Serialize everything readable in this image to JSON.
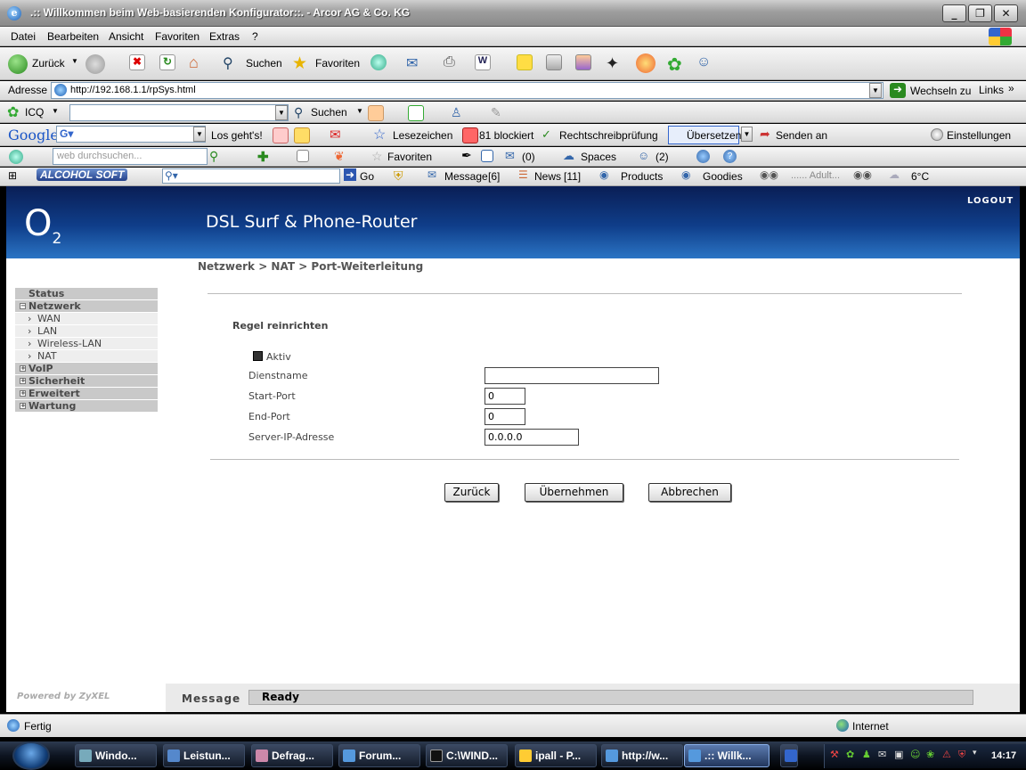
{
  "window": {
    "title": ".:: Willkommen beim Web-basierenden Konfigurator::. - Arcor AG & Co. KG"
  },
  "menubar": [
    "Datei",
    "Bearbeiten",
    "Ansicht",
    "Favoriten",
    "Extras",
    "?"
  ],
  "nav": {
    "back": "Zurück",
    "search": "Suchen",
    "favorites": "Favoriten"
  },
  "address": {
    "label": "Adresse",
    "url": "http://192.168.1.1/rpSys.html",
    "go": "Wechseln zu",
    "links": "Links"
  },
  "icq": {
    "label": "ICQ",
    "search": "Suchen"
  },
  "google": {
    "logo": "Google",
    "go": "Los geht's!",
    "bookmarks": "Lesezeichen",
    "blocked": "81 blockiert",
    "spell": "Rechtschreibprüfung",
    "translate": "Übersetzen",
    "send": "Senden an",
    "settings": "Einstellungen"
  },
  "web": {
    "placeholder": "web durchsuchen...",
    "favorites": "Favoriten",
    "mail": "(0)",
    "spaces": "Spaces",
    "contacts": "(2)"
  },
  "alcohol": {
    "logo": "ALCOHOL SOFT",
    "go": "Go",
    "message": "Message",
    "message_count": "[6]",
    "news": "News",
    "news_count": "[11]",
    "products": "Products",
    "goodies": "Goodies",
    "adult": "...... Adult...",
    "temp": "6°C"
  },
  "router": {
    "brand": "O",
    "brand_sub": "2",
    "product": "DSL Surf & Phone-Router",
    "logout": "LOGOUT",
    "breadcrumb": "Netzwerk > NAT > Port-Weiterleitung",
    "menu": {
      "status": "Status",
      "netzwerk": "Netzwerk",
      "wan": "WAN",
      "lan": "LAN",
      "wlan": "Wireless-LAN",
      "nat": "NAT",
      "voip": "VoIP",
      "sicherheit": "Sicherheit",
      "erweitert": "Erweitert",
      "wartung": "Wartung"
    },
    "form": {
      "heading": "Regel reinrichten",
      "active_label": "Aktiv",
      "service_label": "Dienstname",
      "service_value": "",
      "start_label": "Start-Port",
      "start_value": "0",
      "end_label": "End-Port",
      "end_value": "0",
      "ip_label": "Server-IP-Adresse",
      "ip_value": "0.0.0.0"
    },
    "buttons": {
      "back": "Zurück",
      "apply": "Übernehmen",
      "cancel": "Abbrechen"
    },
    "powered": "Powered by ZyXEL",
    "message_label": "Message",
    "message_value": "Ready"
  },
  "status": {
    "left": "Fertig",
    "zone": "Internet"
  },
  "taskbar": {
    "items": [
      "Windo...",
      "Leistun...",
      "Defrag...",
      "Forum...",
      "C:\\WIND...",
      "ipall - P...",
      "http://w...",
      ".:: Willk..."
    ],
    "clock": "14:17"
  }
}
